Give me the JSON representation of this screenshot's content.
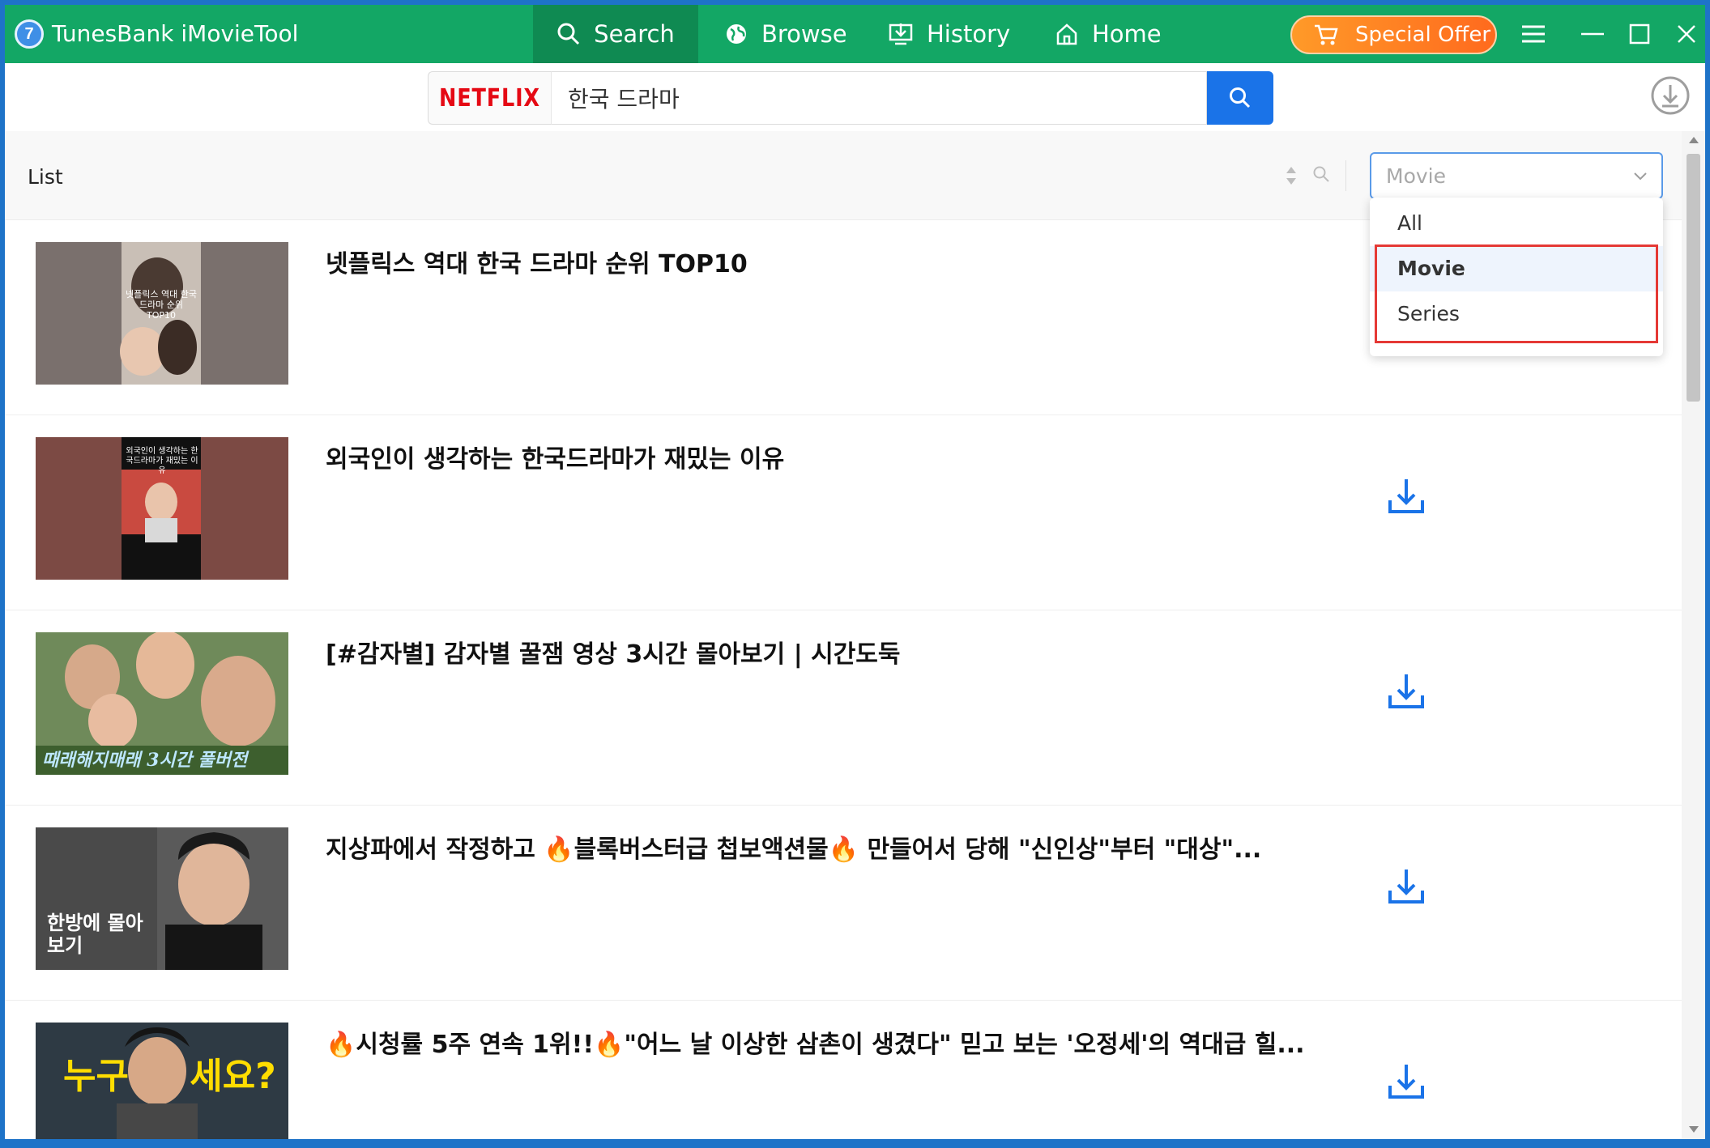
{
  "app": {
    "title": "TunesBank iMovieTool",
    "logo_glyph": "7",
    "accent_color": "#13a765"
  },
  "nav": {
    "tabs": [
      {
        "label": "Search",
        "icon": "search-icon",
        "active": true
      },
      {
        "label": "Browse",
        "icon": "globe-icon",
        "active": false
      },
      {
        "label": "History",
        "icon": "download-history-icon",
        "active": false
      },
      {
        "label": "Home",
        "icon": "home-icon",
        "active": false
      }
    ],
    "offer_label": "Special Offer"
  },
  "search": {
    "service_logo": "NETFLIX",
    "query": "한국 드라마"
  },
  "list": {
    "title": "List",
    "filter_value": "Movie",
    "filter_options": [
      "All",
      "Movie",
      "Series"
    ],
    "selected_option": "Movie",
    "items": [
      {
        "title": "넷플릭스 역대 한국 드라마 순위 TOP10",
        "thumb_text": "넷플릭스 역대 한국 드라마 순위 TOP10"
      },
      {
        "title": "외국인이 생각하는 한국드라마가 재밌는 이유",
        "thumb_text": "외국인이 생각하는 한국드라마가 재밌는 이유"
      },
      {
        "title": "[#감자별] 감자별 꿀잼 영상 3시간 몰아보기 | 시간도둑",
        "thumb_text": "때래해지매래 3시간 풀버전"
      },
      {
        "title": "지상파에서 작정하고 🔥블록버스터급 첩보액션물🔥 만들어서 당해 \"신인상\"부터 \"대상\"...",
        "thumb_text": "한방에 몰아보기"
      },
      {
        "title": "🔥시청률 5주 연속 1위!!🔥\"어느 날 이상한 삼촌이 생겼다\" 믿고 보는 '오정세'의 역대급 힐...",
        "thumb_text": "누구 세요?"
      }
    ]
  }
}
